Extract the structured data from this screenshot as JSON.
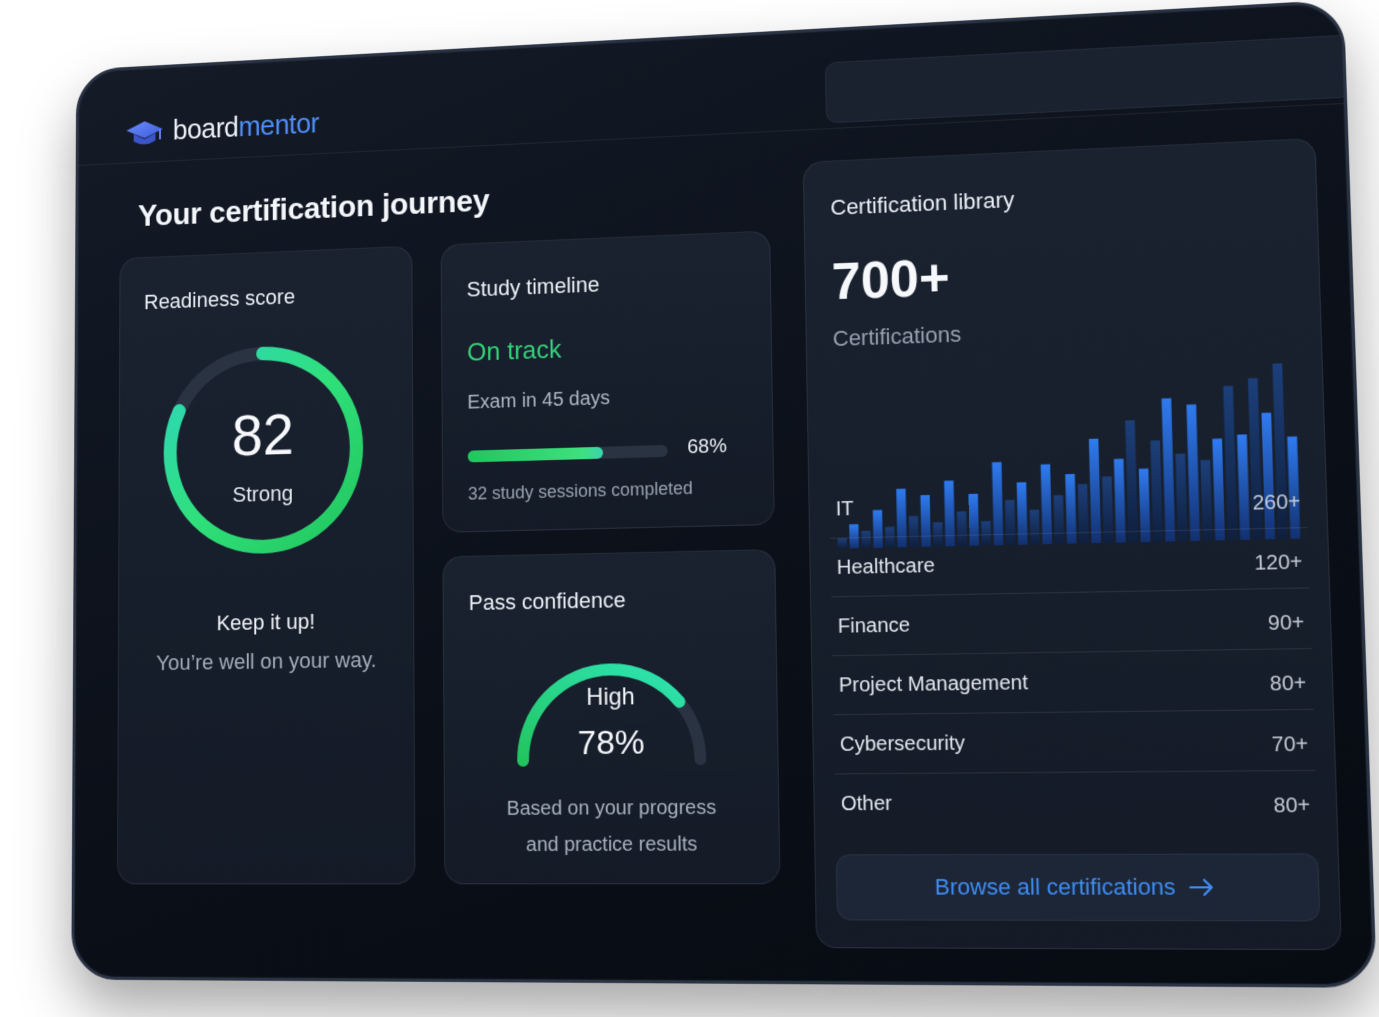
{
  "brand": {
    "name_a": "board",
    "name_b": "mentor",
    "color": "#4f8df7"
  },
  "page_title": "Your certification journey",
  "readiness": {
    "title": "Readiness score",
    "score": "82",
    "score_value": 82,
    "label": "Strong",
    "headline": "Keep it up!",
    "message": "You’re well on your way."
  },
  "timeline": {
    "title": "Study timeline",
    "status": "On track",
    "exam": "Exam in 45 days",
    "progress_label": "68%",
    "progress_value": 0.68,
    "sessions": "32 study sessions completed"
  },
  "confidence": {
    "title": "Pass confidence",
    "level": "High",
    "percent": "78%",
    "percent_value": 0.78,
    "note_line1": "Based on your progress",
    "note_line2": "and practice results"
  },
  "library": {
    "title": "Certification library",
    "count": "700+",
    "subtitle": "Certifications",
    "categories": [
      {
        "name": "IT",
        "count": "260+"
      },
      {
        "name": "Healthcare",
        "count": "120+"
      },
      {
        "name": "Finance",
        "count": "90+"
      },
      {
        "name": "Project Management",
        "count": "80+"
      },
      {
        "name": "Cybersecurity",
        "count": "70+"
      },
      {
        "name": "Other",
        "count": "80+"
      }
    ],
    "browse_label": "Browse all certifications"
  },
  "chart_data": {
    "type": "bar",
    "values": [
      6,
      14,
      10,
      22,
      12,
      34,
      18,
      30,
      14,
      38,
      20,
      30,
      14,
      48,
      26,
      36,
      20,
      46,
      28,
      40,
      34,
      60,
      38,
      48,
      70,
      42,
      58,
      82,
      50,
      78,
      46,
      58,
      88,
      60,
      92,
      72,
      100,
      58
    ],
    "highlight_every": 2,
    "colors": {
      "primary": "#2f7bf0",
      "secondary": "#1c3f7a"
    }
  },
  "colors": {
    "accent_green": "#34d27a",
    "accent_blue": "#3f8df5",
    "ring_track": "#2a3342"
  }
}
